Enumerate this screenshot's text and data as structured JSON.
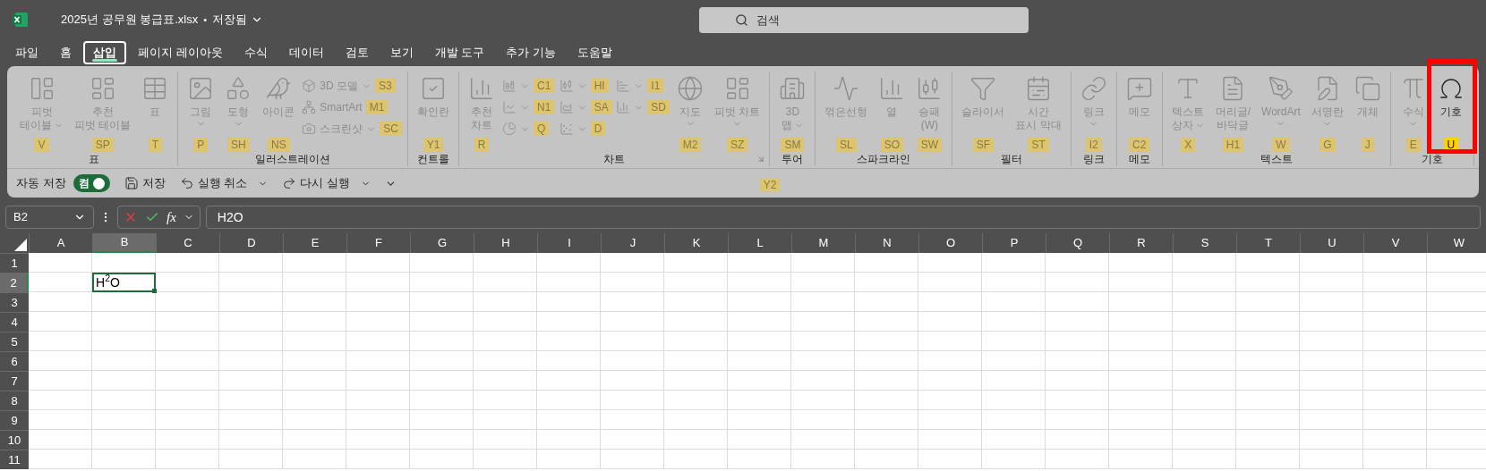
{
  "title_bar": {
    "file_name": "2025년 공무원 봉급표.xlsx",
    "separator": "•",
    "save_status": "저장됨",
    "search": {
      "placeholder": "검색"
    }
  },
  "menu_tabs": [
    {
      "label": "파일",
      "selected": false
    },
    {
      "label": "홈",
      "selected": false
    },
    {
      "label": "삽입",
      "selected": true
    },
    {
      "label": "페이지 레이아웃",
      "selected": false
    },
    {
      "label": "수식",
      "selected": false
    },
    {
      "label": "데이터",
      "selected": false
    },
    {
      "label": "검토",
      "selected": false
    },
    {
      "label": "보기",
      "selected": false
    },
    {
      "label": "개발 도구",
      "selected": false
    },
    {
      "label": "추가 기능",
      "selected": false
    },
    {
      "label": "도움말",
      "selected": false
    }
  ],
  "ribbon": {
    "groups": [
      {
        "label": "표",
        "items": [
          {
            "kind": "large",
            "lines": [
              "피벗",
              "테이블"
            ],
            "dropdown": true,
            "keytip": "V",
            "disabled": true
          },
          {
            "kind": "large",
            "lines": [
              "추천",
              "피벗 테이블"
            ],
            "dropdown": false,
            "keytip": "SP",
            "disabled": true
          },
          {
            "kind": "large",
            "lines": [
              "표"
            ],
            "dropdown": false,
            "keytip": "T",
            "disabled": true
          }
        ]
      },
      {
        "label": "일러스트레이션",
        "items": [
          {
            "kind": "large",
            "lines": [
              "그림"
            ],
            "dropdown": true,
            "keytip": "P",
            "disabled": true
          },
          {
            "kind": "large",
            "lines": [
              "도형"
            ],
            "dropdown": true,
            "keytip": "SH",
            "disabled": true
          },
          {
            "kind": "large",
            "lines": [
              "아이콘"
            ],
            "dropdown": false,
            "keytip": "NS",
            "disabled": true
          },
          {
            "kind": "small",
            "lines": [
              "3D 모델"
            ],
            "dropdown": true,
            "keytip": "S3",
            "disabled": true
          },
          {
            "kind": "small",
            "lines": [
              "SmartArt"
            ],
            "dropdown": false,
            "keytip": "M1",
            "disabled": true
          },
          {
            "kind": "small",
            "lines": [
              "스크린샷"
            ],
            "dropdown": true,
            "keytip": "SC",
            "disabled": true
          }
        ]
      },
      {
        "label": "컨트롤",
        "items": [
          {
            "kind": "large",
            "lines": [
              "확인란"
            ],
            "dropdown": false,
            "keytip": "Y1",
            "disabled": true
          }
        ]
      },
      {
        "label": "차트",
        "launcher_keytip": "Y2",
        "items": [
          {
            "kind": "large",
            "lines": [
              "추천",
              "차트"
            ],
            "dropdown": false,
            "keytip": "R",
            "disabled": true
          },
          {
            "kind": "icon",
            "dropdown": true,
            "keytip": "C1",
            "disabled": true
          },
          {
            "kind": "icon",
            "dropdown": true,
            "keytip": "HI",
            "disabled": true
          },
          {
            "kind": "icon",
            "dropdown": true,
            "keytip": "I1",
            "disabled": true
          },
          {
            "kind": "icon",
            "dropdown": true,
            "keytip": "N1",
            "disabled": true
          },
          {
            "kind": "icon",
            "dropdown": true,
            "keytip": "SA",
            "disabled": true
          },
          {
            "kind": "icon",
            "dropdown": true,
            "keytip": "SD",
            "disabled": true
          },
          {
            "kind": "icon",
            "dropdown": true,
            "keytip": "Q",
            "disabled": true
          },
          {
            "kind": "icon",
            "dropdown": true,
            "keytip": "D",
            "disabled": true
          },
          {
            "kind": "large",
            "lines": [
              "지도"
            ],
            "dropdown": true,
            "keytip": "M2",
            "disabled": true
          },
          {
            "kind": "large",
            "lines": [
              "피벗 차트"
            ],
            "dropdown": true,
            "keytip": "SZ",
            "disabled": true
          }
        ]
      },
      {
        "label": "투어",
        "items": [
          {
            "kind": "large",
            "lines": [
              "3D",
              "맵"
            ],
            "dropdown": true,
            "keytip": "SM",
            "disabled": true
          }
        ]
      },
      {
        "label": "스파크라인",
        "items": [
          {
            "kind": "large",
            "lines": [
              "꺾은선형"
            ],
            "dropdown": false,
            "keytip": "SL",
            "disabled": true
          },
          {
            "kind": "large",
            "lines": [
              "열"
            ],
            "dropdown": false,
            "keytip": "SO",
            "disabled": true
          },
          {
            "kind": "large",
            "lines": [
              "승패",
              "(W)"
            ],
            "dropdown": false,
            "keytip": "SW",
            "disabled": true
          }
        ]
      },
      {
        "label": "필터",
        "items": [
          {
            "kind": "large",
            "lines": [
              "슬라이서"
            ],
            "dropdown": false,
            "keytip": "SF",
            "disabled": true
          },
          {
            "kind": "large",
            "lines": [
              "시간",
              "표시 막대"
            ],
            "dropdown": false,
            "keytip": "ST",
            "disabled": true
          }
        ]
      },
      {
        "label": "링크",
        "items": [
          {
            "kind": "large",
            "lines": [
              "링크"
            ],
            "dropdown": true,
            "keytip": "I2",
            "disabled": true
          }
        ]
      },
      {
        "label": "메모",
        "items": [
          {
            "kind": "large",
            "lines": [
              "메모"
            ],
            "dropdown": false,
            "keytip": "C2",
            "disabled": true
          }
        ]
      },
      {
        "label": "텍스트",
        "items": [
          {
            "kind": "large",
            "lines": [
              "텍스트",
              "상자"
            ],
            "dropdown": true,
            "keytip": "X",
            "disabled": true
          },
          {
            "kind": "large",
            "lines": [
              "머리글/",
              "바닥글"
            ],
            "dropdown": false,
            "keytip": "H1",
            "disabled": true
          },
          {
            "kind": "large",
            "lines": [
              "WordArt"
            ],
            "dropdown": true,
            "keytip": "W",
            "disabled": true
          },
          {
            "kind": "large",
            "lines": [
              "서명란"
            ],
            "dropdown": true,
            "keytip": "G",
            "disabled": true
          },
          {
            "kind": "large",
            "lines": [
              "개체"
            ],
            "dropdown": false,
            "keytip": "J",
            "disabled": true
          }
        ]
      },
      {
        "label": "기호",
        "items": [
          {
            "kind": "large",
            "lines": [
              "수식"
            ],
            "dropdown": true,
            "keytip": "E",
            "disabled": true
          },
          {
            "kind": "large",
            "lines": [
              "기호"
            ],
            "dropdown": false,
            "keytip": "U",
            "disabled": false,
            "highlighted": true
          }
        ]
      }
    ]
  },
  "quick_access": {
    "items": [
      {
        "kind": "toggle",
        "label": "자동 저장",
        "on": true,
        "on_text": "켬"
      },
      {
        "kind": "button",
        "label": "저장",
        "dropdown": false
      },
      {
        "kind": "button",
        "label": "실행 취소",
        "dropdown": true
      },
      {
        "kind": "button",
        "label": "다시 실행",
        "dropdown": true
      },
      {
        "kind": "menu"
      }
    ]
  },
  "formula_bar": {
    "name_box": "B2",
    "function_label": "fx",
    "value": "H2O"
  },
  "grid": {
    "columns": [
      {
        "label": "A",
        "selected": false
      },
      {
        "label": "B",
        "selected": true
      },
      {
        "label": "C",
        "selected": false
      },
      {
        "label": "D",
        "selected": false
      },
      {
        "label": "E",
        "selected": false
      },
      {
        "label": "F",
        "selected": false
      },
      {
        "label": "G",
        "selected": false
      },
      {
        "label": "H",
        "selected": false
      },
      {
        "label": "I",
        "selected": false
      },
      {
        "label": "J",
        "selected": false
      },
      {
        "label": "K",
        "selected": false
      },
      {
        "label": "L",
        "selected": false
      },
      {
        "label": "M",
        "selected": false
      },
      {
        "label": "N",
        "selected": false
      },
      {
        "label": "O",
        "selected": false
      },
      {
        "label": "P",
        "selected": false
      },
      {
        "label": "Q",
        "selected": false
      },
      {
        "label": "R",
        "selected": false
      },
      {
        "label": "S",
        "selected": false
      },
      {
        "label": "T",
        "selected": false
      },
      {
        "label": "U",
        "selected": false
      },
      {
        "label": "V",
        "selected": false
      },
      {
        "label": "W",
        "selected": false
      }
    ],
    "rows": [
      {
        "label": "1",
        "selected": false
      },
      {
        "label": "2",
        "selected": true
      },
      {
        "label": "3",
        "selected": false
      },
      {
        "label": "4",
        "selected": false
      },
      {
        "label": "5",
        "selected": false
      },
      {
        "label": "6",
        "selected": false
      },
      {
        "label": "7",
        "selected": false
      },
      {
        "label": "8",
        "selected": false
      },
      {
        "label": "9",
        "selected": false
      },
      {
        "label": "10",
        "selected": false
      },
      {
        "label": "11",
        "selected": false
      }
    ],
    "active_cell": {
      "value": "H$^{2}$O"
    }
  }
}
